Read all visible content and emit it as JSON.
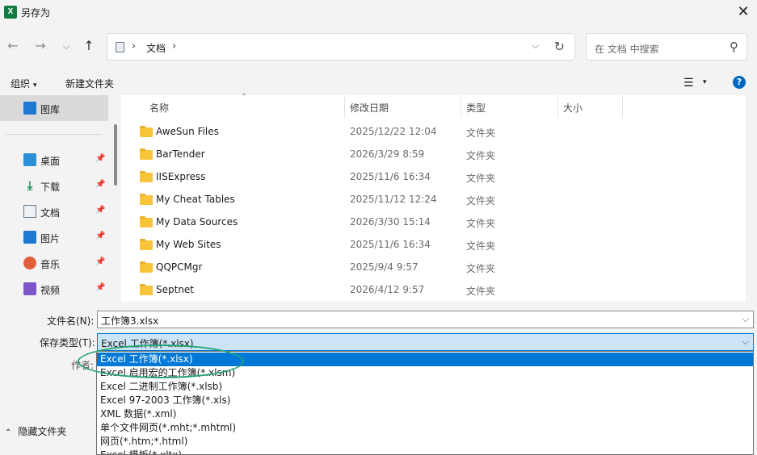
{
  "window": {
    "app_icon_letter": "X",
    "title": "另存为",
    "close_glyph": "✕"
  },
  "nav": {
    "back_glyph": "←",
    "forward_glyph": "→",
    "recent_glyph": "⌵",
    "up_glyph": "↑",
    "breadcrumb_sep": "›",
    "breadcrumb": "文档",
    "dropdown_glyph": "⌵",
    "refresh_glyph": "↻",
    "search_placeholder": "在 文档 中搜索",
    "search_glyph": "⚲"
  },
  "toolbar": {
    "organize": "组织",
    "new_folder": "新建文件夹",
    "caret": "▾",
    "view_glyph": "☰",
    "help_glyph": "?"
  },
  "sidebar": {
    "items": [
      {
        "label": "图库",
        "icon": "gallery-icon"
      },
      {
        "label": "桌面",
        "icon": "desktop-icon",
        "pinned": true
      },
      {
        "label": "下载",
        "icon": "download-icon",
        "pinned": true
      },
      {
        "label": "文档",
        "icon": "document-icon",
        "pinned": true
      },
      {
        "label": "图片",
        "icon": "pictures-icon",
        "pinned": true
      },
      {
        "label": "音乐",
        "icon": "music-icon",
        "pinned": true
      },
      {
        "label": "视频",
        "icon": "video-icon",
        "pinned": true
      }
    ],
    "pin_glyph": "📌",
    "download_glyph": "⤓"
  },
  "files": {
    "columns": {
      "name": "名称",
      "modified": "修改日期",
      "type": "类型",
      "size": "大小"
    },
    "sort_glyph": "⌃",
    "rows": [
      {
        "name": "AweSun Files",
        "modified": "2025/12/22 12:04",
        "type": "文件夹"
      },
      {
        "name": "BarTender",
        "modified": "2026/3/29 8:59",
        "type": "文件夹"
      },
      {
        "name": "IISExpress",
        "modified": "2025/11/6 16:34",
        "type": "文件夹"
      },
      {
        "name": "My Cheat Tables",
        "modified": "2025/11/12 12:24",
        "type": "文件夹"
      },
      {
        "name": "My Data Sources",
        "modified": "2026/3/30 15:14",
        "type": "文件夹"
      },
      {
        "name": "My Web Sites",
        "modified": "2025/11/6 16:34",
        "type": "文件夹"
      },
      {
        "name": "QQPCMgr",
        "modified": "2025/9/4 9:57",
        "type": "文件夹"
      },
      {
        "name": "Septnet",
        "modified": "2026/4/12 9:57",
        "type": "文件夹"
      }
    ]
  },
  "save": {
    "filename_label": "文件名(N):",
    "filename_value": "工作簿3.xlsx",
    "type_label": "保存类型(T):",
    "type_value": "Excel 工作簿(*.xlsx)",
    "author_label": "作者:",
    "chevron_glyph": "⌵",
    "hide_folders_caret": "⌃",
    "hide_folders_label": "隐藏文件夹",
    "type_options": [
      "Excel 工作簿(*.xlsx)",
      "Excel 启用宏的工作簿(*.xlsm)",
      "Excel 二进制工作簿(*.xlsb)",
      "Excel 97-2003 工作簿(*.xls)",
      "XML 数据(*.xml)",
      "单个文件网页(*.mht;*.mhtml)",
      "网页(*.htm;*.html)",
      "Excel 模板(*.xltx)"
    ]
  }
}
